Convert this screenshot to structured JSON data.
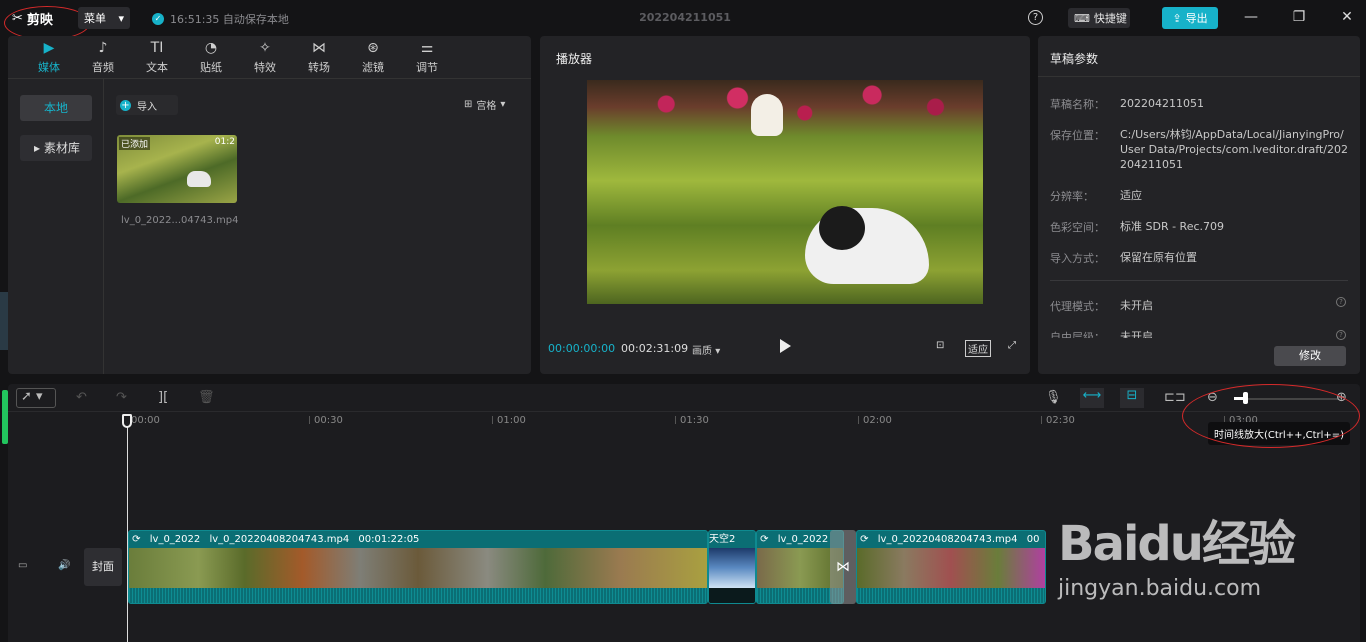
{
  "titlebar": {
    "app_name": "剪映",
    "menu_label": "菜单",
    "autosave": "16:51:35 自动保存本地",
    "project_title": "202204211051",
    "help": "?",
    "shortcut_label": "快捷键",
    "export_label": "导出"
  },
  "toolbar": {
    "tabs": [
      {
        "label": "媒体",
        "icon": "media-icon",
        "glyph": "▶"
      },
      {
        "label": "音频",
        "icon": "audio-icon",
        "glyph": "♪"
      },
      {
        "label": "文本",
        "icon": "text-icon",
        "glyph": "TI"
      },
      {
        "label": "贴纸",
        "icon": "sticker-icon",
        "glyph": "◔"
      },
      {
        "label": "特效",
        "icon": "effects-icon",
        "glyph": "✧"
      },
      {
        "label": "转场",
        "icon": "transition-icon",
        "glyph": "⋈"
      },
      {
        "label": "滤镜",
        "icon": "filter-icon",
        "glyph": "⊛"
      },
      {
        "label": "调节",
        "icon": "adjust-icon",
        "glyph": "⚌"
      }
    ]
  },
  "media": {
    "side_local": "本地",
    "side_library": "素材库",
    "import_label": "导入",
    "sort_label": "宫格",
    "thumb_added": "已添加",
    "thumb_duration": "01:2",
    "thumb_name": "lv_0_2022...04743.mp4"
  },
  "player": {
    "title": "播放器",
    "time_current": "00:00:00:00",
    "time_total": "00:02:31:09",
    "quality": "画质",
    "fit": "适应"
  },
  "draft": {
    "title": "草稿参数",
    "props": [
      {
        "label": "草稿名称：",
        "value": "202204211051"
      },
      {
        "label": "保存位置：",
        "value": "C:/Users/林钧/AppData/Local/JianyingPro/User Data/Projects/com.lveditor.draft/202204211051"
      },
      {
        "label": "分辨率：",
        "value": "适应"
      },
      {
        "label": "色彩空间：",
        "value": "标准 SDR - Rec.709"
      },
      {
        "label": "导入方式：",
        "value": "保留在原有位置"
      },
      {
        "label": "代理模式：",
        "value": "未开启"
      },
      {
        "label": "自由层级：",
        "value": "未开启"
      }
    ],
    "modify_label": "修改"
  },
  "timeline": {
    "ruler": [
      "00:00",
      "00:30",
      "01:00",
      "01:30",
      "02:00",
      "02:30",
      "03:00"
    ],
    "tooltip": "时间线放大(Ctrl++,Ctrl+=)",
    "cover_label": "封面",
    "clips": [
      {
        "labels": [
          "lv_0_2022",
          "lv_0_20220408204743.mp4",
          "00:01:22:05"
        ]
      },
      {
        "labels": [
          "天空2"
        ]
      },
      {
        "labels": [
          "lv_0_2022"
        ]
      },
      {
        "labels": [
          "lv_0_20220408204743.mp4",
          "00"
        ]
      }
    ]
  },
  "watermark": {
    "main": "Baidu经验",
    "sub": "jingyan.baidu.com"
  }
}
